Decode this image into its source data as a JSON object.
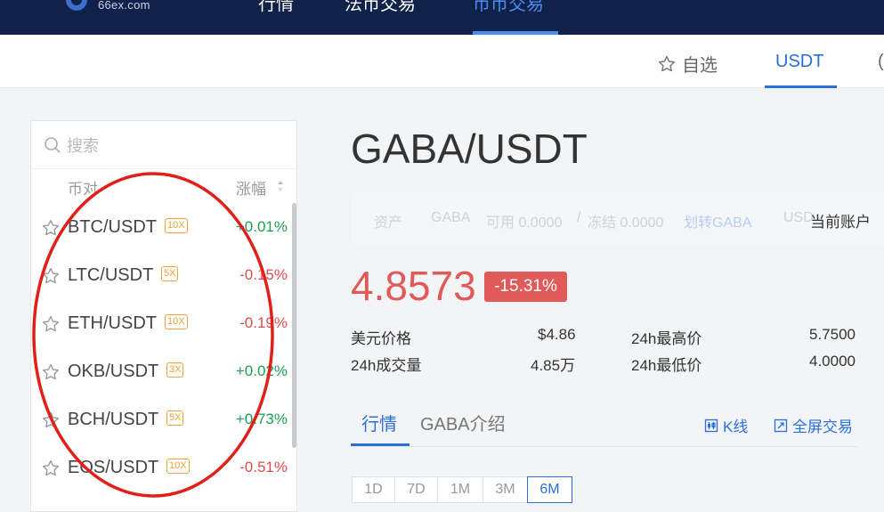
{
  "header": {
    "logo_text": "66ex.com",
    "nav": [
      "行情",
      "法币交易",
      "币币交易"
    ]
  },
  "subnav": {
    "favorites": "自选",
    "usdt": "USDT",
    "cut": "("
  },
  "sidebar": {
    "search_placeholder": "搜索",
    "col_pair": "币对",
    "col_change": "涨幅",
    "rows": [
      {
        "pair": "BTC/USDT",
        "lev": "10X",
        "chg": "+0.01%"
      },
      {
        "pair": "LTC/USDT",
        "lev": "5X",
        "chg": "-0.15%"
      },
      {
        "pair": "ETH/USDT",
        "lev": "10X",
        "chg": "-0.19%"
      },
      {
        "pair": "OKB/USDT",
        "lev": "3X",
        "chg": "+0.02%"
      },
      {
        "pair": "BCH/USDT",
        "lev": "5X",
        "chg": "+0.73%"
      },
      {
        "pair": "EOS/USDT",
        "lev": "10X",
        "chg": "-0.51%"
      }
    ]
  },
  "main": {
    "title": "GABA/USDT",
    "account": {
      "asset_label": "资产",
      "coin": "GABA",
      "available": "可用 0.0000",
      "sep": "/",
      "frozen": "冻结 0.0000",
      "transfer": "划转GABA",
      "quote": "USD",
      "current_account": "当前账户"
    },
    "price": "4.8573",
    "change_badge": "-15.31%",
    "stats": {
      "usd_label": "美元价格",
      "usd_value": "$4.86",
      "high_label": "24h最高价",
      "high_value": "5.7500",
      "vol_label": "24h成交量",
      "vol_value": "4.85万",
      "low_label": "24h最低价",
      "low_value": "4.0000"
    },
    "tabs": [
      "行情",
      "GABA介绍"
    ],
    "kline": "K线",
    "fullscreen": "全屏交易",
    "periods": [
      "1D",
      "7D",
      "1M",
      "3M",
      "6M"
    ]
  },
  "colors": {
    "header_bg": "#10214a",
    "accent": "#2a6fdb",
    "up": "#1f9d55",
    "down": "#e04c4c",
    "leverage": "#f0a130",
    "annotation": "#e0201a"
  }
}
